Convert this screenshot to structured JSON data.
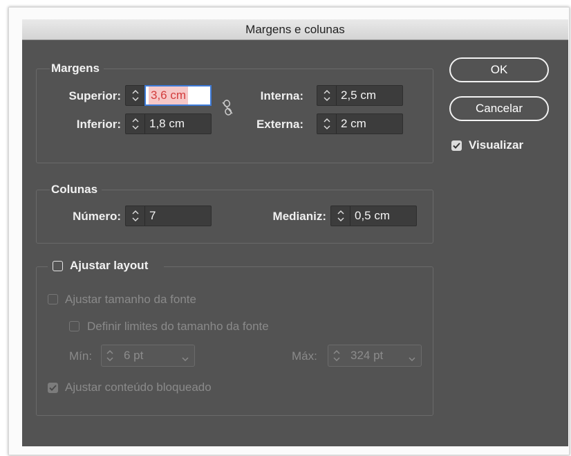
{
  "dialog": {
    "title": "Margens e colunas"
  },
  "margins": {
    "legend": "Margens",
    "top_label": "Superior:",
    "top_value": "3,6 cm",
    "bottom_label": "Inferior:",
    "bottom_value": "1,8 cm",
    "inside_label": "Interna:",
    "inside_value": "2,5 cm",
    "outside_label": "Externa:",
    "outside_value": "2 cm"
  },
  "columns": {
    "legend": "Colunas",
    "number_label": "Número:",
    "number_value": "7",
    "gutter_label": "Medianiz:",
    "gutter_value": "0,5 cm"
  },
  "adjust": {
    "legend": "Ajustar layout",
    "font_size_label": "Ajustar tamanho da fonte",
    "font_limits_label": "Definir limites do tamanho da fonte",
    "min_label": "Mín:",
    "min_value": "6 pt",
    "max_label": "Máx:",
    "max_value": "324 pt",
    "locked_label": "Ajustar conteúdo bloqueado"
  },
  "buttons": {
    "ok": "OK",
    "cancel": "Cancelar"
  },
  "preview": {
    "label": "Visualizar",
    "checked": true
  },
  "colors": {
    "dialog_bg": "#535353",
    "field_bg": "#3c3c3c",
    "focus": "#3d7bd9",
    "selection": "#f6c8c8"
  },
  "icons": [
    "stepper-icon",
    "chain-link-icon",
    "chevron-down-icon",
    "checkmark-icon"
  ]
}
